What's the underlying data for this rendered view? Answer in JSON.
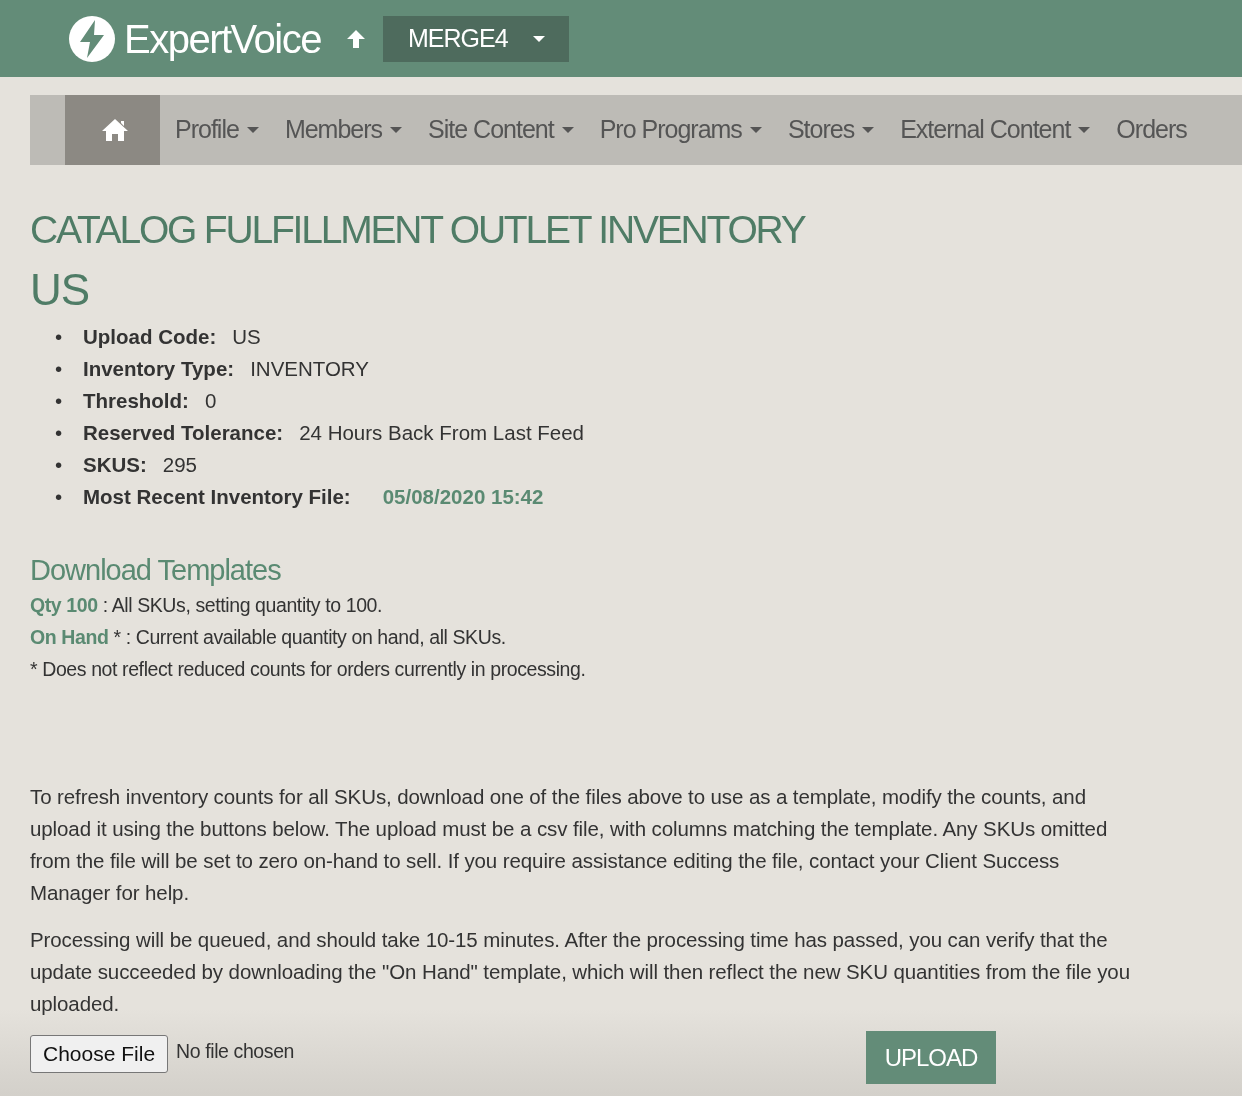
{
  "header": {
    "brand": "ExpertVoice",
    "environment": "MERGE4"
  },
  "nav": [
    {
      "kind": "home",
      "selected": true
    },
    {
      "kind": "link",
      "label": "Profile",
      "has_menu": true,
      "selected": false
    },
    {
      "kind": "link",
      "label": "Members",
      "has_menu": true,
      "selected": false
    },
    {
      "kind": "link",
      "label": "Site Content",
      "has_menu": true,
      "selected": false
    },
    {
      "kind": "link",
      "label": "Pro Programs",
      "has_menu": true,
      "selected": false
    },
    {
      "kind": "link",
      "label": "Stores",
      "has_menu": true,
      "selected": false
    },
    {
      "kind": "link",
      "label": "External Content",
      "has_menu": true,
      "selected": false
    },
    {
      "kind": "link",
      "label": "Orders",
      "has_menu": false,
      "selected": false
    }
  ],
  "title": "CATALOG FULFILLMENT OUTLET INVENTORY",
  "subtitle": "US",
  "details": [
    {
      "marker": "•",
      "label": "Upload Code:",
      "value": "US",
      "kind": "text"
    },
    {
      "marker": "•",
      "label": "Inventory Type:",
      "value": "INVENTORY",
      "kind": "text"
    },
    {
      "marker": "•",
      "label": "Threshold:",
      "value": "0",
      "kind": "text"
    },
    {
      "marker": "•",
      "label": "Reserved Tolerance:",
      "value": "24 Hours Back From Last Feed",
      "kind": "text"
    },
    {
      "marker": "•",
      "label": "SKUS:",
      "value": "295",
      "kind": "text"
    },
    {
      "marker": "•",
      "label": "Most Recent Inventory File:",
      "value": "05/08/2020 15:42",
      "kind": "link"
    }
  ],
  "templates": {
    "heading": "Download Templates",
    "items": [
      {
        "link": "Qty 100",
        "description": " : All SKUs, setting quantity to 100."
      },
      {
        "link": "On Hand",
        "description": " * : Current available quantity on hand, all SKUs."
      }
    ],
    "footnote": "* Does not reflect reduced counts for orders currently in processing."
  },
  "paragraphs": [
    "To refresh inventory counts for all SKUs, download one of the files above to use as a template, modify the counts, and upload it using the buttons below. The upload must be a csv file, with columns matching the template. Any SKUs omitted from the file will be set to zero on-hand to sell. If you require assistance editing the file, contact your Client Success Manager for help.",
    "Processing will be queued, and should take 10-15 minutes. After the processing time has passed, you can verify that the update succeeded by downloading the \"On Hand\" template, which will then reflect the new SKU quantities from the file you uploaded."
  ],
  "upload": {
    "choose_label": "Choose File",
    "file_status": "No file chosen",
    "button": "UPLOAD"
  }
}
